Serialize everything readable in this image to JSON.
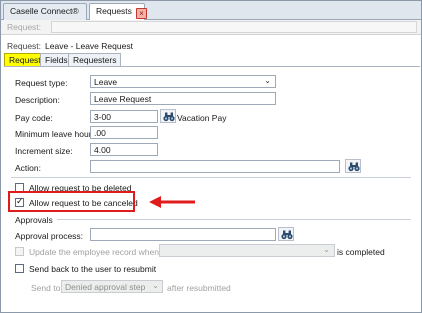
{
  "tabs": {
    "caselle": "Caselle Connect®",
    "requests": "Requests",
    "close_glyph": "×"
  },
  "greybar": {
    "label": "Request:"
  },
  "request_line": {
    "label": "Request:",
    "value": "Leave - Leave Request"
  },
  "inner_tabs": [
    "Request",
    "Fields",
    "Requesters"
  ],
  "form": {
    "request_type": {
      "label": "Request type:",
      "value": "Leave"
    },
    "description": {
      "label": "Description:",
      "value": "Leave Request"
    },
    "pay_code": {
      "label": "Pay code:",
      "value": "3-00",
      "desc": "Vacation Pay"
    },
    "min_leave_hours": {
      "label": "Minimum leave hours:",
      "value": ".00"
    },
    "increment_size": {
      "label": "Increment size:",
      "value": "4.00"
    },
    "action": {
      "label": "Action:",
      "value": ""
    }
  },
  "checkboxes": {
    "allow_deleted": {
      "label": "Allow request to be deleted",
      "checked": false
    },
    "allow_canceled": {
      "label": "Allow request to be canceled",
      "checked": true
    }
  },
  "approvals": {
    "heading": "Approvals",
    "approval_process": {
      "label": "Approval process:",
      "value": ""
    },
    "update_employee": {
      "label": "Update the employee record when",
      "suffix": "is completed",
      "checked": false,
      "disabled": true
    },
    "send_back": {
      "label": "Send back to the user to resubmit",
      "checked": false
    },
    "send_to": {
      "label": "Send to",
      "value": "Denied approval step",
      "suffix": "after resubmitted"
    }
  },
  "colors": {
    "highlight": "#ffff00",
    "annotation": "#e01b1b"
  }
}
